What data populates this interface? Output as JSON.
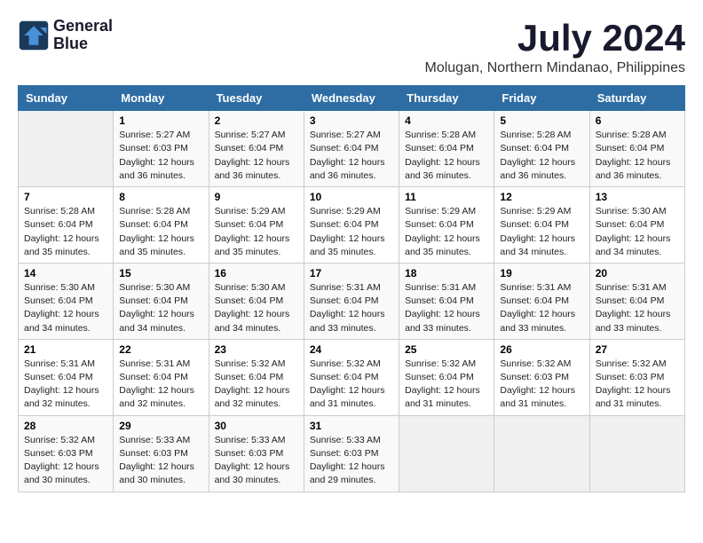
{
  "logo": {
    "line1": "General",
    "line2": "Blue"
  },
  "title": "July 2024",
  "location": "Molugan, Northern Mindanao, Philippines",
  "weekdays": [
    "Sunday",
    "Monday",
    "Tuesday",
    "Wednesday",
    "Thursday",
    "Friday",
    "Saturday"
  ],
  "weeks": [
    [
      {
        "day": "",
        "info": ""
      },
      {
        "day": "1",
        "info": "Sunrise: 5:27 AM\nSunset: 6:03 PM\nDaylight: 12 hours\nand 36 minutes."
      },
      {
        "day": "2",
        "info": "Sunrise: 5:27 AM\nSunset: 6:04 PM\nDaylight: 12 hours\nand 36 minutes."
      },
      {
        "day": "3",
        "info": "Sunrise: 5:27 AM\nSunset: 6:04 PM\nDaylight: 12 hours\nand 36 minutes."
      },
      {
        "day": "4",
        "info": "Sunrise: 5:28 AM\nSunset: 6:04 PM\nDaylight: 12 hours\nand 36 minutes."
      },
      {
        "day": "5",
        "info": "Sunrise: 5:28 AM\nSunset: 6:04 PM\nDaylight: 12 hours\nand 36 minutes."
      },
      {
        "day": "6",
        "info": "Sunrise: 5:28 AM\nSunset: 6:04 PM\nDaylight: 12 hours\nand 36 minutes."
      }
    ],
    [
      {
        "day": "7",
        "info": "Sunrise: 5:28 AM\nSunset: 6:04 PM\nDaylight: 12 hours\nand 35 minutes."
      },
      {
        "day": "8",
        "info": "Sunrise: 5:28 AM\nSunset: 6:04 PM\nDaylight: 12 hours\nand 35 minutes."
      },
      {
        "day": "9",
        "info": "Sunrise: 5:29 AM\nSunset: 6:04 PM\nDaylight: 12 hours\nand 35 minutes."
      },
      {
        "day": "10",
        "info": "Sunrise: 5:29 AM\nSunset: 6:04 PM\nDaylight: 12 hours\nand 35 minutes."
      },
      {
        "day": "11",
        "info": "Sunrise: 5:29 AM\nSunset: 6:04 PM\nDaylight: 12 hours\nand 35 minutes."
      },
      {
        "day": "12",
        "info": "Sunrise: 5:29 AM\nSunset: 6:04 PM\nDaylight: 12 hours\nand 34 minutes."
      },
      {
        "day": "13",
        "info": "Sunrise: 5:30 AM\nSunset: 6:04 PM\nDaylight: 12 hours\nand 34 minutes."
      }
    ],
    [
      {
        "day": "14",
        "info": "Sunrise: 5:30 AM\nSunset: 6:04 PM\nDaylight: 12 hours\nand 34 minutes."
      },
      {
        "day": "15",
        "info": "Sunrise: 5:30 AM\nSunset: 6:04 PM\nDaylight: 12 hours\nand 34 minutes."
      },
      {
        "day": "16",
        "info": "Sunrise: 5:30 AM\nSunset: 6:04 PM\nDaylight: 12 hours\nand 34 minutes."
      },
      {
        "day": "17",
        "info": "Sunrise: 5:31 AM\nSunset: 6:04 PM\nDaylight: 12 hours\nand 33 minutes."
      },
      {
        "day": "18",
        "info": "Sunrise: 5:31 AM\nSunset: 6:04 PM\nDaylight: 12 hours\nand 33 minutes."
      },
      {
        "day": "19",
        "info": "Sunrise: 5:31 AM\nSunset: 6:04 PM\nDaylight: 12 hours\nand 33 minutes."
      },
      {
        "day": "20",
        "info": "Sunrise: 5:31 AM\nSunset: 6:04 PM\nDaylight: 12 hours\nand 33 minutes."
      }
    ],
    [
      {
        "day": "21",
        "info": "Sunrise: 5:31 AM\nSunset: 6:04 PM\nDaylight: 12 hours\nand 32 minutes."
      },
      {
        "day": "22",
        "info": "Sunrise: 5:31 AM\nSunset: 6:04 PM\nDaylight: 12 hours\nand 32 minutes."
      },
      {
        "day": "23",
        "info": "Sunrise: 5:32 AM\nSunset: 6:04 PM\nDaylight: 12 hours\nand 32 minutes."
      },
      {
        "day": "24",
        "info": "Sunrise: 5:32 AM\nSunset: 6:04 PM\nDaylight: 12 hours\nand 31 minutes."
      },
      {
        "day": "25",
        "info": "Sunrise: 5:32 AM\nSunset: 6:04 PM\nDaylight: 12 hours\nand 31 minutes."
      },
      {
        "day": "26",
        "info": "Sunrise: 5:32 AM\nSunset: 6:03 PM\nDaylight: 12 hours\nand 31 minutes."
      },
      {
        "day": "27",
        "info": "Sunrise: 5:32 AM\nSunset: 6:03 PM\nDaylight: 12 hours\nand 31 minutes."
      }
    ],
    [
      {
        "day": "28",
        "info": "Sunrise: 5:32 AM\nSunset: 6:03 PM\nDaylight: 12 hours\nand 30 minutes."
      },
      {
        "day": "29",
        "info": "Sunrise: 5:33 AM\nSunset: 6:03 PM\nDaylight: 12 hours\nand 30 minutes."
      },
      {
        "day": "30",
        "info": "Sunrise: 5:33 AM\nSunset: 6:03 PM\nDaylight: 12 hours\nand 30 minutes."
      },
      {
        "day": "31",
        "info": "Sunrise: 5:33 AM\nSunset: 6:03 PM\nDaylight: 12 hours\nand 29 minutes."
      },
      {
        "day": "",
        "info": ""
      },
      {
        "day": "",
        "info": ""
      },
      {
        "day": "",
        "info": ""
      }
    ]
  ]
}
